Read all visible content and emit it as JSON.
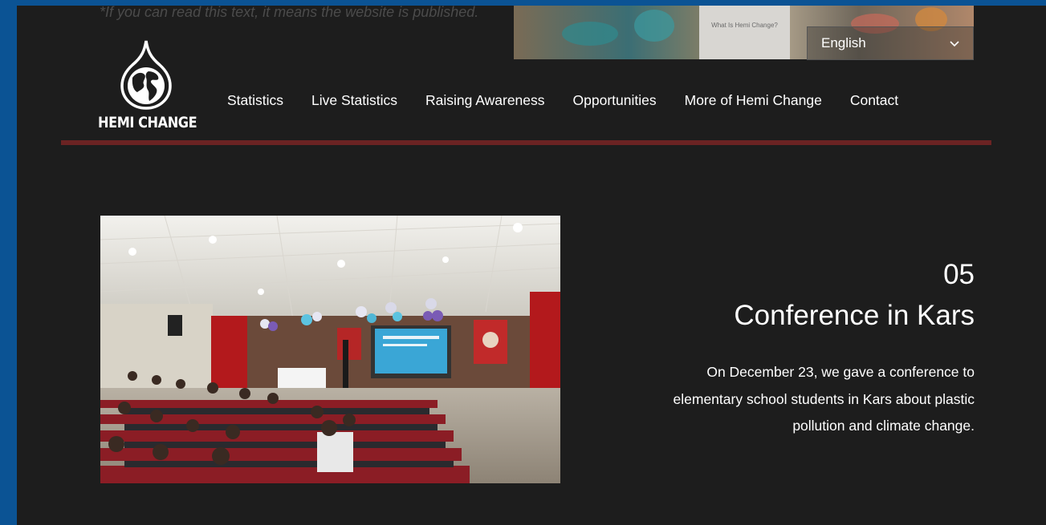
{
  "header": {
    "faded_text": "*If you can read this text, it means the website is published.",
    "banner_card_text": "What Is Hemi Change?",
    "language": "English"
  },
  "logo": {
    "text": "HEMI CHANGE"
  },
  "nav": {
    "items": [
      "Statistics",
      "Live Statistics",
      "Raising Awareness",
      "Opportunities",
      "More of Hemi Change",
      "Contact"
    ]
  },
  "feature": {
    "number": "05",
    "title": "Conference in Kars",
    "description": "On December 23, we gave a conference to elementary school students in Kars about plastic pollution and climate change."
  },
  "colors": {
    "frame": "#0b5394",
    "background": "#1d1d1d",
    "divider": "#6b2323",
    "text": "#ffffff"
  }
}
